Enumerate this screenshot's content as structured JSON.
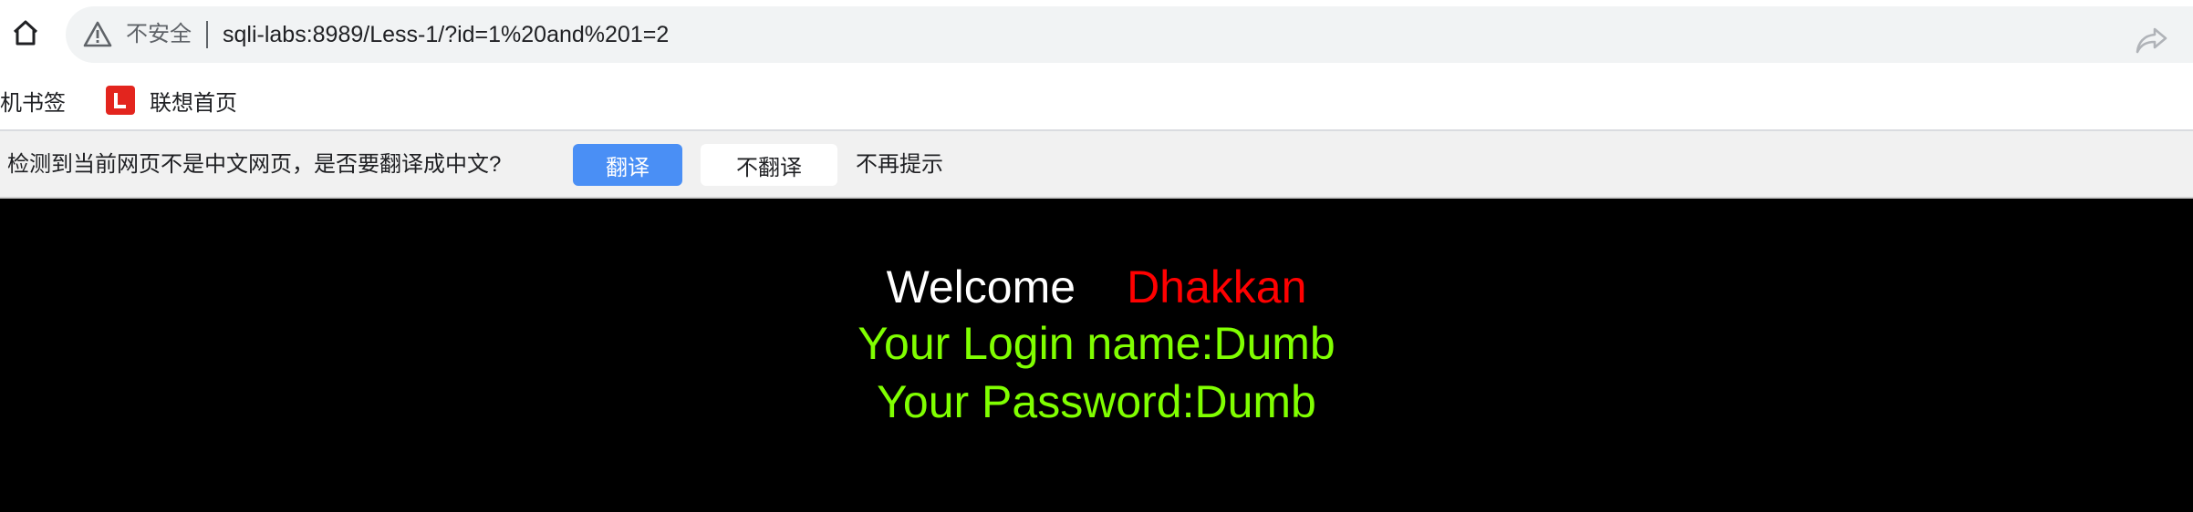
{
  "browser": {
    "security_label": "不安全",
    "url": "sqli-labs:8989/Less-1/?id=1%20and%201=2"
  },
  "bookmarks": {
    "items": [
      {
        "label": "手机书签"
      },
      {
        "label": "联想首页"
      }
    ]
  },
  "translate_bar": {
    "prompt": "检测到当前网页不是中文网页，是否要翻译成中文?",
    "translate_label": "翻译",
    "no_translate_label": "不翻译",
    "dont_remind_label": "不再提示"
  },
  "page": {
    "welcome": "Welcome",
    "user": "Dhakkan",
    "login_name": "Your Login name:Dumb",
    "password": "Your Password:Dumb"
  }
}
